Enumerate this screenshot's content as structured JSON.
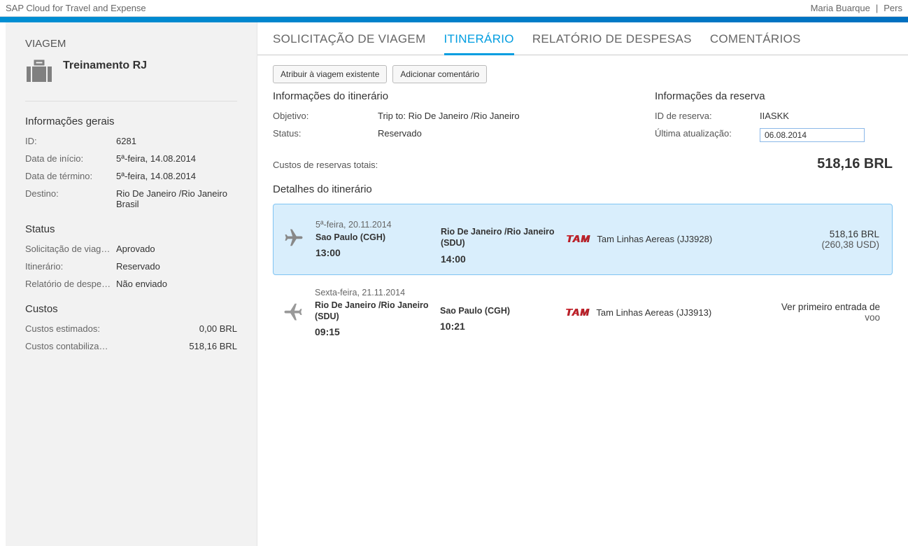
{
  "topbar": {
    "app_title": "SAP Cloud for Travel and Expense",
    "user": "Maria Buarque",
    "menu": "Pers"
  },
  "sidebar": {
    "heading": "VIAGEM",
    "trip_name": "Treinamento RJ",
    "general_title": "Informações gerais",
    "general": [
      {
        "k": "ID:",
        "v": "6281"
      },
      {
        "k": "Data de início:",
        "v": "5ª-feira, 14.08.2014"
      },
      {
        "k": "Data de término:",
        "v": "5ª-feira, 14.08.2014"
      },
      {
        "k": "Destino:",
        "v": "Rio De Janeiro /Rio Janeiro Brasil"
      }
    ],
    "status_title": "Status",
    "status": [
      {
        "k": "Solicitação de viag…",
        "v": "Aprovado"
      },
      {
        "k": "Itinerário:",
        "v": "Reservado"
      },
      {
        "k": "Relatório de despe…",
        "v": "Não enviado"
      }
    ],
    "costs_title": "Custos",
    "costs": [
      {
        "k": "Custos estimados:",
        "v": "0,00 BRL"
      },
      {
        "k": "Custos contabiliza…",
        "v": "518,16 BRL"
      }
    ]
  },
  "tabs": [
    {
      "label": "SOLICITAÇÃO DE VIAGEM",
      "active": false
    },
    {
      "label": "ITINERÁRIO",
      "active": true
    },
    {
      "label": "RELATÓRIO DE DESPESAS",
      "active": false
    },
    {
      "label": "COMENTÁRIOS",
      "active": false
    }
  ],
  "toolbar": {
    "assign": "Atribuir à viagem existente",
    "comment": "Adicionar comentário"
  },
  "itinerary": {
    "info_title": "Informações do itinerário",
    "info": [
      {
        "k": "Objetivo:",
        "v": "Trip to: Rio De Janeiro /Rio Janeiro"
      },
      {
        "k": "Status:",
        "v": "Reservado"
      }
    ],
    "reservation_title": "Informações da reserva",
    "reservation": [
      {
        "k": "ID de reserva:",
        "v": "IIASKK"
      },
      {
        "k": "Última atualização:",
        "v": "06.08.2014",
        "boxed": true
      }
    ],
    "total_label": "Custos de reservas totais:",
    "total_value": "518,16 BRL",
    "details_title": "Detalhes do itinerário",
    "segments": [
      {
        "selected": true,
        "date": "5ª-feira, 20.11.2014",
        "dep_loc": "Sao Paulo (CGH)",
        "dep_time": "13:00",
        "arr_loc": "Rio De Janeiro /Rio Janeiro (SDU)",
        "arr_time": "14:00",
        "airline_logo": "TAM",
        "airline": "Tam Linhas Aereas (JJ3928)",
        "price1": "518,16 BRL",
        "price2": "(260,38 USD)"
      },
      {
        "selected": false,
        "date": "Sexta-feira, 21.11.2014",
        "dep_loc": "Rio De Janeiro /Rio Janeiro (SDU)",
        "dep_time": "09:15",
        "arr_loc": "Sao Paulo (CGH)",
        "arr_time": "10:21",
        "airline_logo": "TAM",
        "airline": "Tam Linhas Aereas (JJ3913)",
        "price1": "Ver primeiro entrada de",
        "price2": "voo"
      }
    ]
  }
}
